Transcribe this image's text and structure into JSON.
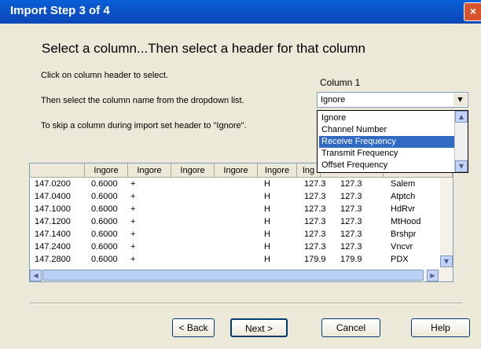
{
  "window": {
    "title": "Import Step 3 of 4",
    "close_glyph": "×"
  },
  "heading": "Select a column...Then select a header for that column",
  "instructions": [
    "Click on column header to select.",
    "Then select the column name from the dropdown list.",
    "To skip a column during import set header to \"Ignore\"."
  ],
  "column_selector": {
    "label": "Column 1",
    "value": "Ignore",
    "options": [
      "Ignore",
      "Channel Number",
      "Receive Frequency",
      "Transmit Frequency",
      "Offset Frequency"
    ],
    "highlighted": "Receive Frequency"
  },
  "grid": {
    "headers": [
      "",
      "Ingore",
      "Ingore",
      "Ingore",
      "Ingore",
      "Ingore",
      "Ing",
      "",
      ""
    ],
    "rows": [
      [
        "147.0200",
        "0.6000",
        "+",
        "",
        "",
        "H",
        "127.3",
        "127.3",
        "Salem"
      ],
      [
        "147.0400",
        "0.6000",
        "+",
        "",
        "",
        "H",
        "127.3",
        "127.3",
        "Atptch"
      ],
      [
        "147.1000",
        "0.6000",
        "+",
        "",
        "",
        "H",
        "127.3",
        "127.3",
        "HdRvr"
      ],
      [
        "147.1200",
        "0.6000",
        "+",
        "",
        "",
        "H",
        "127.3",
        "127.3",
        "MtHood"
      ],
      [
        "147.1400",
        "0.6000",
        "+",
        "",
        "",
        "H",
        "127.3",
        "127.3",
        "Brshpr"
      ],
      [
        "147.2400",
        "0.6000",
        "+",
        "",
        "",
        "H",
        "127.3",
        "127.3",
        "Vncvr"
      ],
      [
        "147.2800",
        "0.6000",
        "+",
        "",
        "",
        "H",
        "179.9",
        "179.9",
        "PDX"
      ]
    ]
  },
  "buttons": {
    "back": "< Back",
    "next": "Next >",
    "cancel": "Cancel",
    "help": "Help"
  },
  "colors": {
    "title_bar": "#0b4fc4",
    "dialog_bg": "#ece9d8",
    "selection": "#316ac5"
  }
}
